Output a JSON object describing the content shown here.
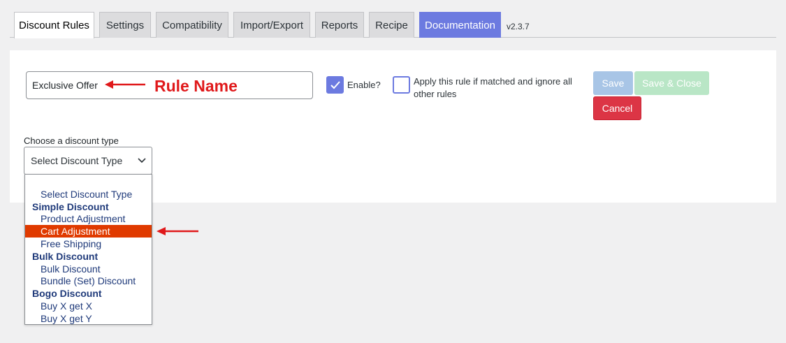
{
  "tabs": [
    {
      "label": "Discount Rules",
      "active": true
    },
    {
      "label": "Settings"
    },
    {
      "label": "Compatibility"
    },
    {
      "label": "Import/Export"
    },
    {
      "label": "Reports"
    },
    {
      "label": "Recipe"
    },
    {
      "label": "Documentation"
    }
  ],
  "version": "v2.3.7",
  "rule": {
    "name_value": "Exclusive Offer",
    "annotation_label": "Rule Name",
    "enable_label": "Enable?",
    "enable_checked": true,
    "apply_label": "Apply this rule if matched and ignore all other rules",
    "apply_checked": false
  },
  "buttons": {
    "save": "Save",
    "save_close": "Save & Close",
    "cancel": "Cancel"
  },
  "discount_type": {
    "label": "Choose a discount type",
    "selected": "Select Discount Type",
    "options": [
      {
        "label": "Select Discount Type",
        "kind": "option"
      },
      {
        "label": "Simple Discount",
        "kind": "group"
      },
      {
        "label": "Product Adjustment",
        "kind": "option"
      },
      {
        "label": "Cart Adjustment",
        "kind": "option",
        "highlighted": true
      },
      {
        "label": "Free Shipping",
        "kind": "option"
      },
      {
        "label": "Bulk Discount",
        "kind": "group"
      },
      {
        "label": "Bulk Discount",
        "kind": "option"
      },
      {
        "label": "Bundle (Set) Discount",
        "kind": "option"
      },
      {
        "label": "Bogo Discount",
        "kind": "group"
      },
      {
        "label": "Buy X get X",
        "kind": "option"
      },
      {
        "label": "Buy X get Y",
        "kind": "option"
      }
    ]
  },
  "colors": {
    "accent": "#6c7ae0",
    "annotation": "#e0191b",
    "highlight": "#e03a00",
    "cancel": "#dc3545"
  }
}
